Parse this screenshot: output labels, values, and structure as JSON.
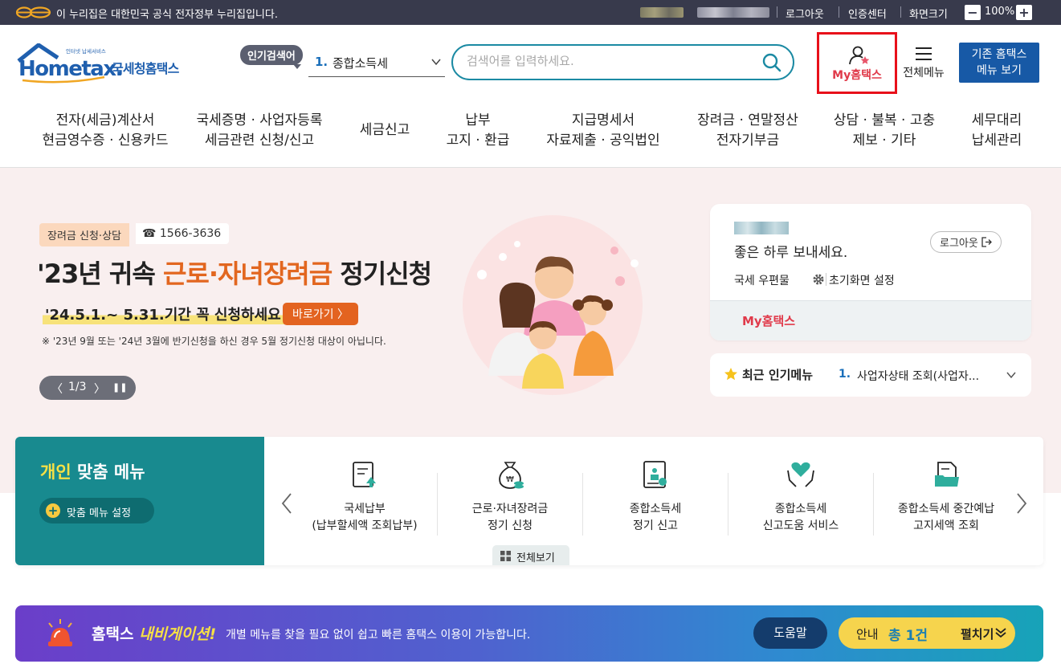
{
  "topbar": {
    "gov_notice": "이 누리집은 대한민국 공식 전자정부 누리집입니다.",
    "logout": "로그아웃",
    "cert_center": "인증센터",
    "screen_size": "화면크기",
    "zoom_out": "−",
    "zoom_value": "100%",
    "zoom_in": "+"
  },
  "header": {
    "logo_small": "인터넷 납세서비스",
    "logo_main": "Hometax.",
    "logo_sub": "국세청홈택스",
    "popular_badge": "인기검색어",
    "popular_rank": "1.",
    "popular_term": "종합소득세",
    "search_placeholder": "검색어를 입력하세요.",
    "my_hometax": "My홈택스",
    "all_menu": "전체메뉴",
    "old_home_line1": "기존 홈택스",
    "old_home_line2": "메뉴 보기"
  },
  "gnb": [
    {
      "line1": "전자(세금)계산서",
      "line2": "현금영수증 · 신용카드"
    },
    {
      "line1": "국세증명 · 사업자등록",
      "line2": "세금관련 신청/신고"
    },
    {
      "line1": "세금신고",
      "line2": ""
    },
    {
      "line1": "납부",
      "line2": "고지 · 환급"
    },
    {
      "line1": "지급명세서",
      "line2": "자료제출 · 공익법인"
    },
    {
      "line1": "장려금 · 연말정산",
      "line2": "전자기부금"
    },
    {
      "line1": "상담 · 불복 · 고충",
      "line2": "제보 · 기타"
    },
    {
      "line1": "세무대리",
      "line2": "납세관리"
    }
  ],
  "banner": {
    "tag": "장려금 신청·상담",
    "phone": "☎ 1566-3636",
    "title_pre": "'23년 귀속 ",
    "title_highlight": "근로·자녀장려금",
    "title_post": " 정기신청",
    "subtitle": "'24.5.1.~ 5.31.기간 꼭 신청하세요!",
    "go_button": "바로가기 〉",
    "note": "※ '23년 9월 또는 '24년 3월에 반기신청을 하신 경우 5월 정기신청 대상이 아닙니다.",
    "pager_prev": "〈",
    "pager_text": "1/3",
    "pager_next": "〉",
    "pager_pause": "❚❚"
  },
  "login_box": {
    "greeting": "좋은 하루 보내세요.",
    "logout": "로그아웃",
    "post_office": "국세 우편물",
    "init_setting": "초기화면 설정",
    "my_hometax": "My홈택스"
  },
  "recent_menu": {
    "title": "최근 인기메뉴",
    "rank": "1.",
    "item": "사업자상태 조회(사업자..."
  },
  "custom_menu": {
    "title_highlight": "개인",
    "title_rest": " 맞춤 메뉴",
    "setting_button": "맞춤 메뉴 설정",
    "items": [
      {
        "line1": "국세납부",
        "line2": "(납부할세액 조회납부)",
        "icon": "tax-payment-icon"
      },
      {
        "line1": "근로·자녀장려금",
        "line2": "정기 신청",
        "icon": "money-bag-icon"
      },
      {
        "line1": "종합소득세",
        "line2": "정기 신고",
        "icon": "tax-report-icon"
      },
      {
        "line1": "종합소득세",
        "line2": "신고도움 서비스",
        "icon": "heart-hands-icon"
      },
      {
        "line1": "종합소득세 중간예납",
        "line2": "고지세액 조회",
        "icon": "document-folder-icon"
      }
    ],
    "view_all": "전체보기"
  },
  "navigation": {
    "title_pre": "홈택스 ",
    "title_highlight": "내비게이션!",
    "description": "개별 메뉴를 찾을 필요 없이 쉽고 빠른 홈택스 이용이 가능합니다.",
    "help": "도움말",
    "notice_label": "안내",
    "notice_count": "총 1건",
    "expand": "펼치기"
  }
}
